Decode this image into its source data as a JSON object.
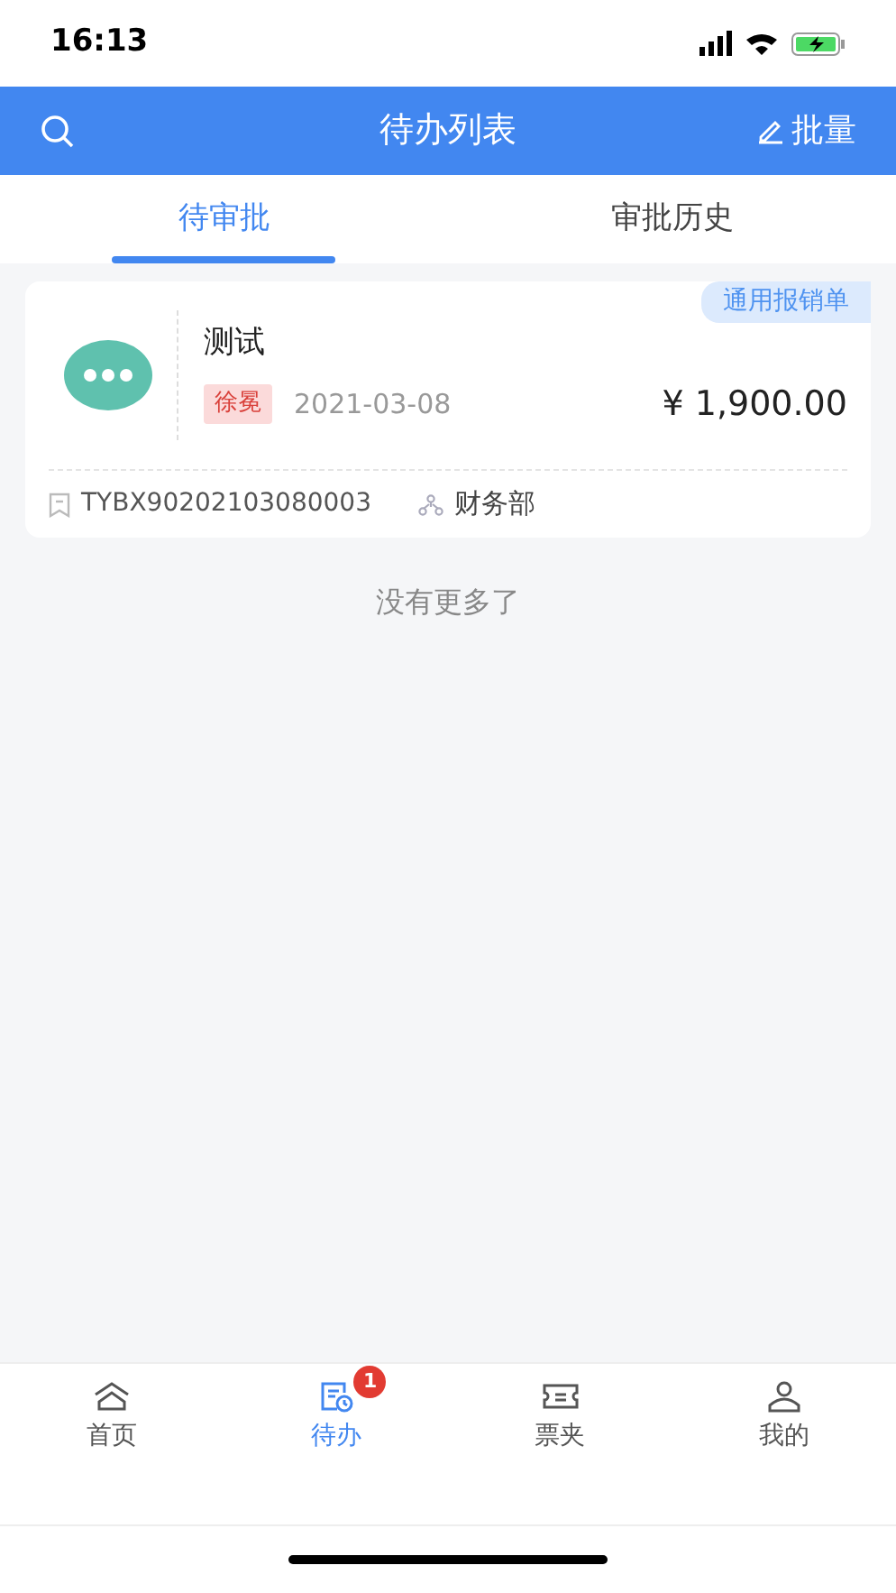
{
  "status_bar": {
    "time": "16:13"
  },
  "header": {
    "title": "待办列表",
    "action": "批量"
  },
  "tabs": [
    {
      "label": "待审批",
      "selected": true
    },
    {
      "label": "审批历史",
      "selected": false
    }
  ],
  "items": [
    {
      "title": "测试",
      "applicant": "徐冕",
      "date": "2021-03-08",
      "amount": "¥ 1,900.00",
      "type_tag": "通用报销单",
      "number": "TYBX90202103080003",
      "department": "财务部"
    }
  ],
  "end_note": "没有更多了",
  "bottom_nav": [
    {
      "kind": "home",
      "label": "首页",
      "selected": false
    },
    {
      "kind": "todo",
      "label": "待办",
      "selected": true,
      "badge": "1"
    },
    {
      "kind": "ticket",
      "label": "票夹",
      "selected": false
    },
    {
      "kind": "user",
      "label": "我的",
      "selected": false
    }
  ]
}
